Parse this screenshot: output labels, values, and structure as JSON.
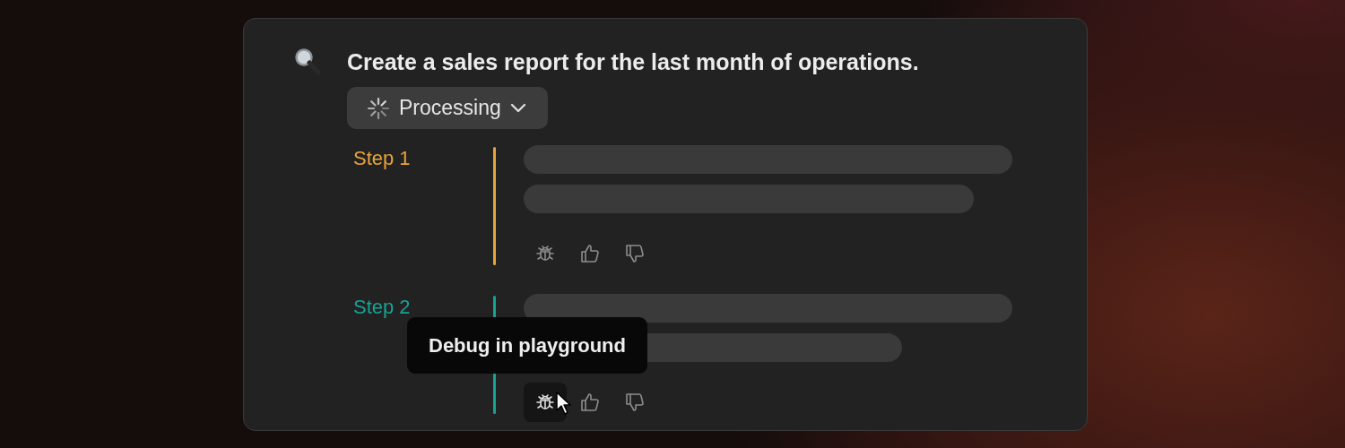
{
  "query": "Create a sales report for the last month of operations.",
  "status_button": {
    "label": "Processing"
  },
  "steps": [
    {
      "label": "Step 1",
      "color": "#e8a33a",
      "actions": [
        {
          "kind": "debug",
          "hovered": false
        },
        {
          "kind": "like",
          "hovered": false
        },
        {
          "kind": "dislike",
          "hovered": false
        }
      ]
    },
    {
      "label": "Step 2",
      "color": "#16a394",
      "actions": [
        {
          "kind": "debug",
          "hovered": true
        },
        {
          "kind": "like",
          "hovered": false
        },
        {
          "kind": "dislike",
          "hovered": false
        }
      ]
    }
  ],
  "tooltip": {
    "text": "Debug in playground"
  }
}
